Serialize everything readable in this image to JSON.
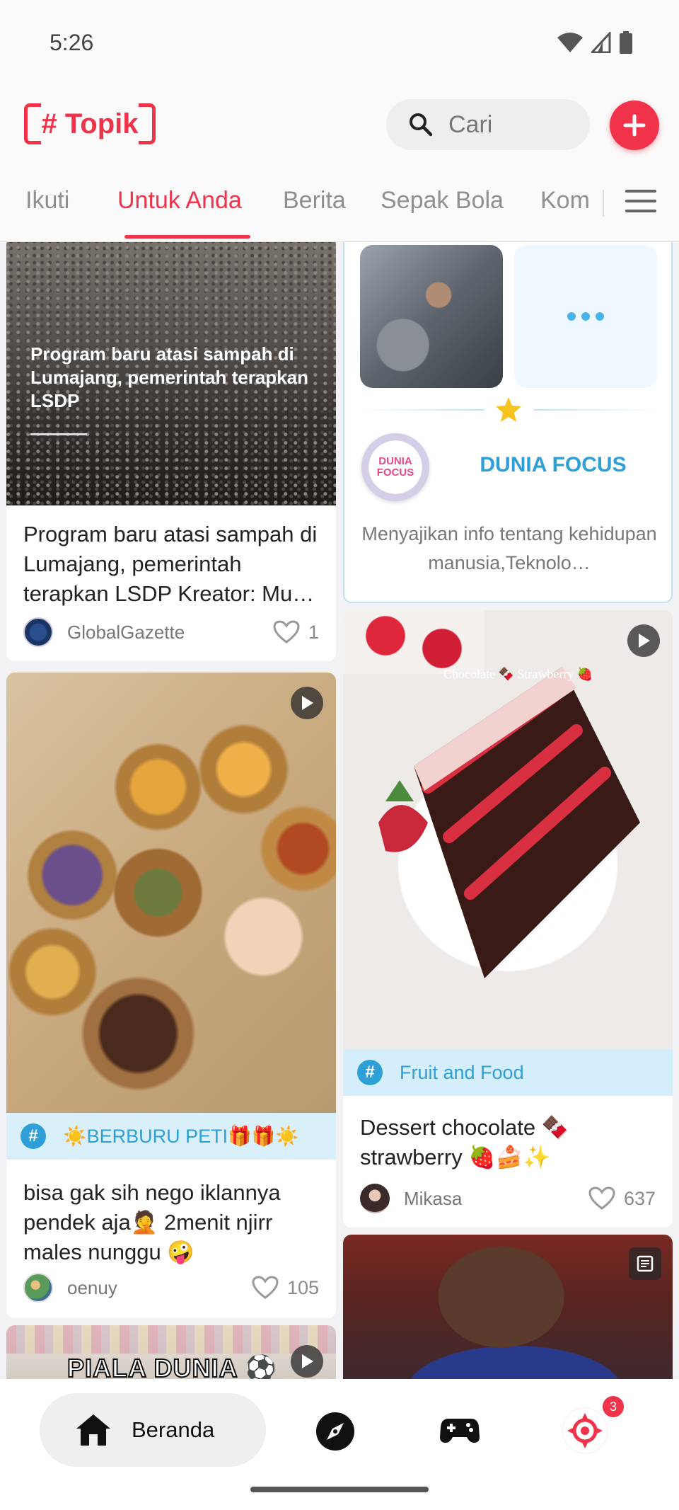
{
  "status_bar": {
    "time": "5:26"
  },
  "header": {
    "logo_text": "# Topik",
    "search_placeholder": "Cari",
    "accent_color": "#f0324a"
  },
  "tabs": [
    {
      "label": "Ikuti",
      "active": false
    },
    {
      "label": "Untuk Anda",
      "active": true
    },
    {
      "label": "Berita",
      "active": false
    },
    {
      "label": "Sepak Bola",
      "active": false
    },
    {
      "label": "Kom",
      "active": false
    }
  ],
  "feed": {
    "left": [
      {
        "image_caption": "Program baru atasi sampah di Lumajang, pemerintah terapkan LSDP",
        "title": "Program baru atasi sampah di Lumajang, pemerintah terapkan LSDP Kreator: Mu…",
        "author": "GlobalGazette",
        "likes": "1"
      },
      {
        "topic": "☀️BERBURU PETI🎁🎁☀️",
        "title": "bisa gak sih nego iklannya pendek aja🤦 2menit njirr males nunggu 🤪",
        "author": "oenuy",
        "likes": "105"
      },
      {
        "image_caption": "PIALA DUNIA ⚽"
      }
    ],
    "right": [
      {
        "creator_name": "DUNIA FOCUS",
        "creator_logo_text": "DUNIA FOCUS",
        "creator_desc": "Menyajikan info tentang kehidupan manusia,Teknolo…"
      },
      {
        "image_caption": "Chocolate 🍫 Strawberry 🍓",
        "topic": "Fruit and Food",
        "title": "Dessert chocolate 🍫 strawberry 🍓🍰✨",
        "author": "Mikasa",
        "likes": "637"
      },
      {}
    ]
  },
  "bottom_nav": {
    "home_label": "Beranda",
    "notification_count": "3"
  }
}
